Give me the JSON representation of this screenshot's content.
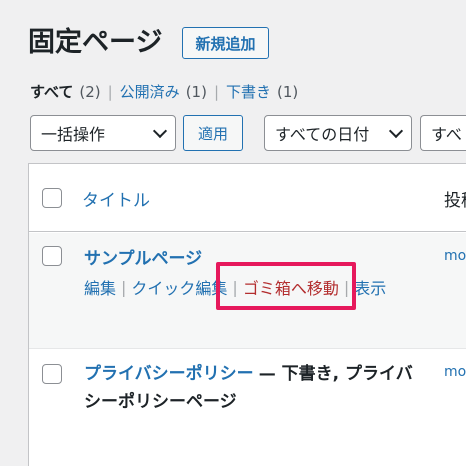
{
  "header": {
    "title": "固定ページ",
    "add_new": "新規追加"
  },
  "filters": {
    "all": {
      "label": "すべて",
      "count": "(2)"
    },
    "published": {
      "label": "公開済み",
      "count": "(1)"
    },
    "draft": {
      "label": "下書き",
      "count": "(1)"
    },
    "sep": "|"
  },
  "toolbar": {
    "bulk_action": "一括操作",
    "apply": "適用",
    "date_filter": "すべての日付",
    "category_filter": "すべ"
  },
  "table": {
    "columns": {
      "title": "タイトル",
      "author": "投稿"
    },
    "rows": [
      {
        "title": "サンプルページ",
        "author": "mo",
        "actions": {
          "edit": "編集",
          "quick_edit": "クイック編集",
          "trash": "ゴミ箱へ移動",
          "view": "表示"
        }
      },
      {
        "title": "プライバシーポリシー",
        "state_line1": "— 下書き, プライバ",
        "state_line2": "シーポリシーページ",
        "author": "mo"
      }
    ]
  },
  "colors": {
    "link": "#2271b1",
    "trash": "#b32d2e",
    "highlight": "#e6195c"
  }
}
